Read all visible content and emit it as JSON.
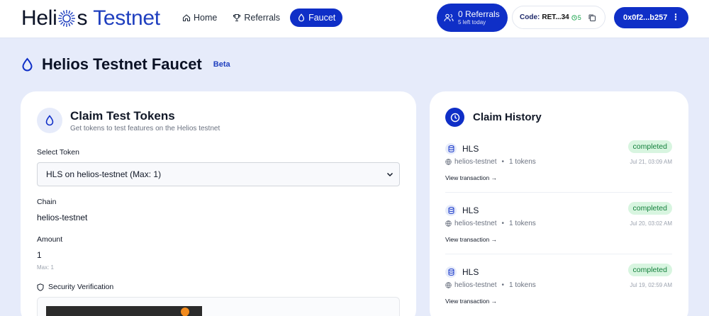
{
  "header": {
    "logo_part1": "Heli",
    "logo_part2": "s",
    "logo_part3": "Testnet",
    "nav": [
      {
        "label": "Home",
        "icon": "home-icon"
      },
      {
        "label": "Referrals",
        "icon": "trophy-icon"
      },
      {
        "label": "Faucet",
        "icon": "droplet-icon",
        "active": true
      }
    ],
    "referrals": {
      "count_label": "0 Referrals",
      "left_label": "5 left today"
    },
    "code": {
      "label": "Code:",
      "value": "RET...34",
      "count": "5"
    },
    "wallet": {
      "address": "0x0f2...b257"
    }
  },
  "page": {
    "title": "Helios Testnet Faucet",
    "badge": "Beta"
  },
  "claim": {
    "title": "Claim Test Tokens",
    "subtitle": "Get tokens to test features on the Helios testnet",
    "select_label": "Select Token",
    "select_value": "HLS on helios-testnet (Max: 1)",
    "chain_label": "Chain",
    "chain_value": "helios-testnet",
    "amount_label": "Amount",
    "amount_value": "1",
    "amount_note": "Max: 1",
    "security_label": "Security Verification"
  },
  "history": {
    "title": "Claim History",
    "items": [
      {
        "token": "HLS",
        "status": "completed",
        "chain": "helios-testnet",
        "amount": "1 tokens",
        "date": "Jul 21, 03:09 AM",
        "link": "View transaction →"
      },
      {
        "token": "HLS",
        "status": "completed",
        "chain": "helios-testnet",
        "amount": "1 tokens",
        "date": "Jul 20, 03:02 AM",
        "link": "View transaction →"
      },
      {
        "token": "HLS",
        "status": "completed",
        "chain": "helios-testnet",
        "amount": "1 tokens",
        "date": "Jul 19, 02:59 AM",
        "link": "View transaction →"
      }
    ]
  },
  "colors": {
    "primary": "#0f2fc7",
    "success": "#15803d",
    "background": "#e6ebfa"
  }
}
